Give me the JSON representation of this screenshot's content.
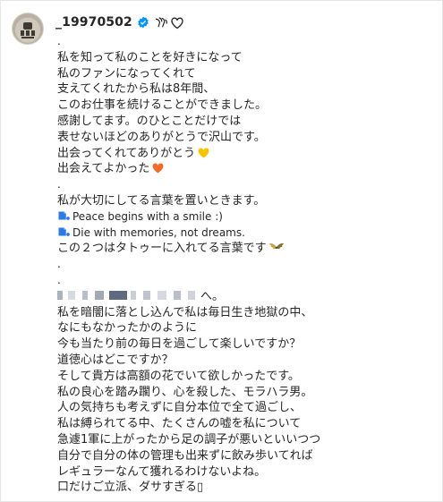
{
  "post": {
    "username": "_19970502",
    "caption_lines": [
      ".",
      "私を知って私のことを好きになって",
      "私のファンになってくれて",
      "支えてくれたから私は8年間、",
      "このお仕事を続けることができました。",
      "感謝してます。のひとことだけでは",
      "表せないほどのありがとうで沢山です。",
      "出会ってくれてありがとう",
      "出会えてよかった",
      ".",
      "私が大切にしてる言葉を置いときます。",
      "Peace begins with a smile :)",
      "Die with memories, not dreams.",
      "この２つはタトゥーに入れてる言葉です",
      ".",
      ".",
      "へ。",
      "私を暗闇に落とし込んで私は毎日生き地獄の中、",
      "なにもなかったかのように",
      "今も当たり前の毎日を過ごして楽しいですか？",
      "道徳心はどこですか？",
      "そして貴方は高額の花でいて欲しかったです。",
      "私の良心を踏み躙り、心を殺した、モラハラ男。",
      "人の気持ちも考えずに自分本位で全て過ごし、",
      "私は縛られてる中、たくさんの嘘を私について",
      "急遽1軍に上がったから足の調子が悪いといいつつ",
      "自分で自分の体の管理も出来ずに飲み歩いてれば",
      "レギュラーなんて獲れるわけないよね。",
      "口だけご立派、ダサすぎる▯"
    ]
  },
  "icons": {
    "verified": "verified-badge-icon",
    "hands": "wing-hands-icon",
    "heart": "heart-outline-icon",
    "yellow_heart": "yellow-heart-icon",
    "orange_heart": "orange-heart-icon",
    "notes": "music-note-icon",
    "wings": "wings-icon"
  },
  "colors": {
    "verified": "#0095f6",
    "yellow_heart": "#f5c400",
    "orange_heart": "#f26b2a",
    "note": "#2c7be5"
  }
}
